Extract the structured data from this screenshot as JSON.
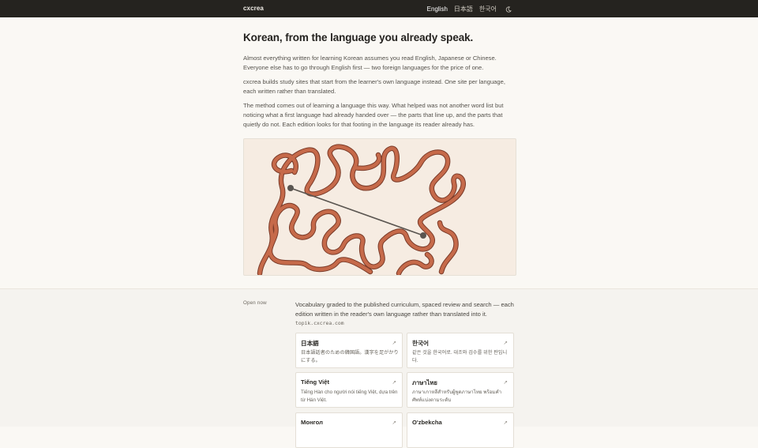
{
  "header": {
    "brand": "cxcrea",
    "languages": [
      "English",
      "日本語",
      "한국어"
    ],
    "active_language": "English",
    "theme_toggle_icon": "moon-icon"
  },
  "intro": {
    "title": "Korean, from the language you already speak.",
    "paragraphs": [
      "Almost everything written for learning Korean assumes you read English, Japanese or Chinese. Everyone else has to go through English first — two foreign languages for the price of one.",
      "cxcrea builds study sites that start from the learner's own language instead. One site per language, each written rather than translated.",
      "The method comes out of learning a language this way. What helped was not another word list but noticing what a first language had already handed over — the parts that line up, and the parts that quietly do not. Each edition looks for that footing in the language its reader already has."
    ]
  },
  "illustration": {
    "semantic": "tangled-line-illustration",
    "colors": {
      "background": "#f6ece2",
      "strand": "#c66a4a",
      "strand_outline": "#7a3b29",
      "connector": "#5a5550"
    }
  },
  "open_now": {
    "label": "Open now",
    "description": "Vocabulary graded to the published curriculum, spaced review and search — each edition written in the reader's own language rather than translated into it.",
    "site": "topik.cxcrea.com",
    "editions": [
      {
        "title": "日本語",
        "subtitle": "日本語話者のための韓国語。漢字を足がかりにする。",
        "arrow": "↗"
      },
      {
        "title": "한국어",
        "subtitle": "같은 것을 한국어로. 대조와 검수를 위한 판입니다.",
        "arrow": "↗"
      },
      {
        "title": "Tiếng Việt",
        "subtitle": "Tiếng Hàn cho người nói tiếng Việt, dựa trên từ Hán Việt.",
        "arrow": "↗"
      },
      {
        "title": "ภาษาไทย",
        "subtitle": "ภาษาเกาหลีสำหรับผู้พูดภาษาไทย พร้อมคำศัพท์แบ่งตามระดับ",
        "arrow": "↗"
      },
      {
        "title": "Монгол",
        "subtitle": "",
        "arrow": "↗"
      },
      {
        "title": "O'zbekcha",
        "subtitle": "",
        "arrow": "↗"
      }
    ]
  }
}
